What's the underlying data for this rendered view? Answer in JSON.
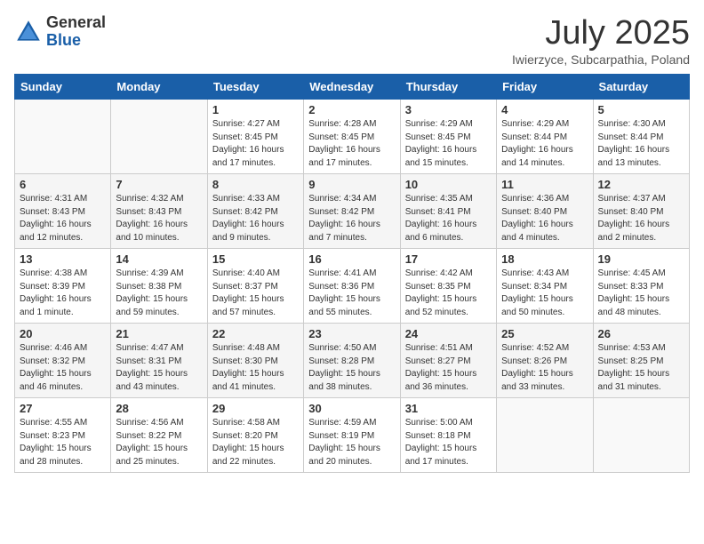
{
  "header": {
    "logo_general": "General",
    "logo_blue": "Blue",
    "month_title": "July 2025",
    "subtitle": "Iwierzyce, Subcarpathia, Poland"
  },
  "weekdays": [
    "Sunday",
    "Monday",
    "Tuesday",
    "Wednesday",
    "Thursday",
    "Friday",
    "Saturday"
  ],
  "weeks": [
    [
      {
        "day": "",
        "sunrise": "",
        "sunset": "",
        "daylight": ""
      },
      {
        "day": "",
        "sunrise": "",
        "sunset": "",
        "daylight": ""
      },
      {
        "day": "1",
        "sunrise": "Sunrise: 4:27 AM",
        "sunset": "Sunset: 8:45 PM",
        "daylight": "Daylight: 16 hours and 17 minutes."
      },
      {
        "day": "2",
        "sunrise": "Sunrise: 4:28 AM",
        "sunset": "Sunset: 8:45 PM",
        "daylight": "Daylight: 16 hours and 17 minutes."
      },
      {
        "day": "3",
        "sunrise": "Sunrise: 4:29 AM",
        "sunset": "Sunset: 8:45 PM",
        "daylight": "Daylight: 16 hours and 15 minutes."
      },
      {
        "day": "4",
        "sunrise": "Sunrise: 4:29 AM",
        "sunset": "Sunset: 8:44 PM",
        "daylight": "Daylight: 16 hours and 14 minutes."
      },
      {
        "day": "5",
        "sunrise": "Sunrise: 4:30 AM",
        "sunset": "Sunset: 8:44 PM",
        "daylight": "Daylight: 16 hours and 13 minutes."
      }
    ],
    [
      {
        "day": "6",
        "sunrise": "Sunrise: 4:31 AM",
        "sunset": "Sunset: 8:43 PM",
        "daylight": "Daylight: 16 hours and 12 minutes."
      },
      {
        "day": "7",
        "sunrise": "Sunrise: 4:32 AM",
        "sunset": "Sunset: 8:43 PM",
        "daylight": "Daylight: 16 hours and 10 minutes."
      },
      {
        "day": "8",
        "sunrise": "Sunrise: 4:33 AM",
        "sunset": "Sunset: 8:42 PM",
        "daylight": "Daylight: 16 hours and 9 minutes."
      },
      {
        "day": "9",
        "sunrise": "Sunrise: 4:34 AM",
        "sunset": "Sunset: 8:42 PM",
        "daylight": "Daylight: 16 hours and 7 minutes."
      },
      {
        "day": "10",
        "sunrise": "Sunrise: 4:35 AM",
        "sunset": "Sunset: 8:41 PM",
        "daylight": "Daylight: 16 hours and 6 minutes."
      },
      {
        "day": "11",
        "sunrise": "Sunrise: 4:36 AM",
        "sunset": "Sunset: 8:40 PM",
        "daylight": "Daylight: 16 hours and 4 minutes."
      },
      {
        "day": "12",
        "sunrise": "Sunrise: 4:37 AM",
        "sunset": "Sunset: 8:40 PM",
        "daylight": "Daylight: 16 hours and 2 minutes."
      }
    ],
    [
      {
        "day": "13",
        "sunrise": "Sunrise: 4:38 AM",
        "sunset": "Sunset: 8:39 PM",
        "daylight": "Daylight: 16 hours and 1 minute."
      },
      {
        "day": "14",
        "sunrise": "Sunrise: 4:39 AM",
        "sunset": "Sunset: 8:38 PM",
        "daylight": "Daylight: 15 hours and 59 minutes."
      },
      {
        "day": "15",
        "sunrise": "Sunrise: 4:40 AM",
        "sunset": "Sunset: 8:37 PM",
        "daylight": "Daylight: 15 hours and 57 minutes."
      },
      {
        "day": "16",
        "sunrise": "Sunrise: 4:41 AM",
        "sunset": "Sunset: 8:36 PM",
        "daylight": "Daylight: 15 hours and 55 minutes."
      },
      {
        "day": "17",
        "sunrise": "Sunrise: 4:42 AM",
        "sunset": "Sunset: 8:35 PM",
        "daylight": "Daylight: 15 hours and 52 minutes."
      },
      {
        "day": "18",
        "sunrise": "Sunrise: 4:43 AM",
        "sunset": "Sunset: 8:34 PM",
        "daylight": "Daylight: 15 hours and 50 minutes."
      },
      {
        "day": "19",
        "sunrise": "Sunrise: 4:45 AM",
        "sunset": "Sunset: 8:33 PM",
        "daylight": "Daylight: 15 hours and 48 minutes."
      }
    ],
    [
      {
        "day": "20",
        "sunrise": "Sunrise: 4:46 AM",
        "sunset": "Sunset: 8:32 PM",
        "daylight": "Daylight: 15 hours and 46 minutes."
      },
      {
        "day": "21",
        "sunrise": "Sunrise: 4:47 AM",
        "sunset": "Sunset: 8:31 PM",
        "daylight": "Daylight: 15 hours and 43 minutes."
      },
      {
        "day": "22",
        "sunrise": "Sunrise: 4:48 AM",
        "sunset": "Sunset: 8:30 PM",
        "daylight": "Daylight: 15 hours and 41 minutes."
      },
      {
        "day": "23",
        "sunrise": "Sunrise: 4:50 AM",
        "sunset": "Sunset: 8:28 PM",
        "daylight": "Daylight: 15 hours and 38 minutes."
      },
      {
        "day": "24",
        "sunrise": "Sunrise: 4:51 AM",
        "sunset": "Sunset: 8:27 PM",
        "daylight": "Daylight: 15 hours and 36 minutes."
      },
      {
        "day": "25",
        "sunrise": "Sunrise: 4:52 AM",
        "sunset": "Sunset: 8:26 PM",
        "daylight": "Daylight: 15 hours and 33 minutes."
      },
      {
        "day": "26",
        "sunrise": "Sunrise: 4:53 AM",
        "sunset": "Sunset: 8:25 PM",
        "daylight": "Daylight: 15 hours and 31 minutes."
      }
    ],
    [
      {
        "day": "27",
        "sunrise": "Sunrise: 4:55 AM",
        "sunset": "Sunset: 8:23 PM",
        "daylight": "Daylight: 15 hours and 28 minutes."
      },
      {
        "day": "28",
        "sunrise": "Sunrise: 4:56 AM",
        "sunset": "Sunset: 8:22 PM",
        "daylight": "Daylight: 15 hours and 25 minutes."
      },
      {
        "day": "29",
        "sunrise": "Sunrise: 4:58 AM",
        "sunset": "Sunset: 8:20 PM",
        "daylight": "Daylight: 15 hours and 22 minutes."
      },
      {
        "day": "30",
        "sunrise": "Sunrise: 4:59 AM",
        "sunset": "Sunset: 8:19 PM",
        "daylight": "Daylight: 15 hours and 20 minutes."
      },
      {
        "day": "31",
        "sunrise": "Sunrise: 5:00 AM",
        "sunset": "Sunset: 8:18 PM",
        "daylight": "Daylight: 15 hours and 17 minutes."
      },
      {
        "day": "",
        "sunrise": "",
        "sunset": "",
        "daylight": ""
      },
      {
        "day": "",
        "sunrise": "",
        "sunset": "",
        "daylight": ""
      }
    ]
  ]
}
